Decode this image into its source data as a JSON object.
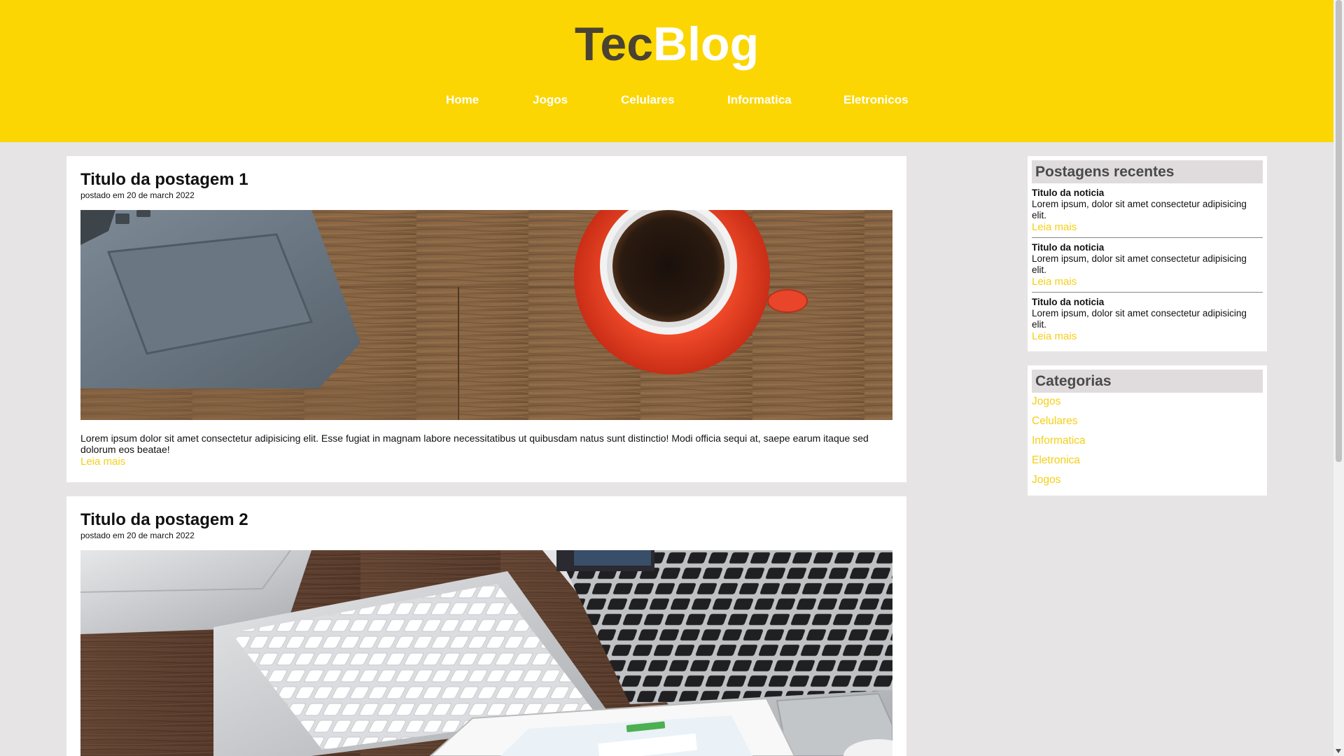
{
  "brand": {
    "part1": "Tec",
    "part2": "Blog"
  },
  "nav": [
    {
      "label": "Home"
    },
    {
      "label": "Jogos"
    },
    {
      "label": "Celulares"
    },
    {
      "label": "Informatica"
    },
    {
      "label": "Eletronicos"
    }
  ],
  "posts": [
    {
      "title": "Titulo da postagem 1",
      "date": "postado em 20 de march 2022",
      "excerpt": "Lorem ipsum dolor sit amet consectetur adipisicing elit. Esse fugiat in magnam labore necessitatibus ut quibusdam natus sunt distinctio! Modi officia sequi at, saepe earum itaque sed dolorum eos beatae!",
      "read_more": "Leia mais",
      "image": "laptop-and-coffee-cup-on-wooden-desk"
    },
    {
      "title": "Titulo da postagem 2",
      "date": "postado em 20 de march 2022",
      "image": "keyboard-macbook-and-tablet-on-wooden-desk"
    }
  ],
  "sidebar": {
    "recent": {
      "title": "Postagens recentes",
      "items": [
        {
          "title": "Titulo da noticia",
          "text": "Lorem ipsum, dolor sit amet consectetur adipisicing elit.",
          "link": "Leia mais"
        },
        {
          "title": "Titulo da noticia",
          "text": "Lorem ipsum, dolor sit amet consectetur adipisicing elit.",
          "link": "Leia mais"
        },
        {
          "title": "Titulo da noticia",
          "text": "Lorem ipsum, dolor sit amet consectetur adipisicing elit.",
          "link": "Leia mais"
        }
      ]
    },
    "categories": {
      "title": "Categorias",
      "items": [
        "Jogos",
        "Celulares",
        "Informatica",
        "Eletronica",
        "Jogos"
      ]
    }
  },
  "colors": {
    "header_bg": "#fbd603",
    "link": "#f5cf16",
    "page_bg": "#e6e4e5",
    "logo_dark": "#4a4332"
  }
}
